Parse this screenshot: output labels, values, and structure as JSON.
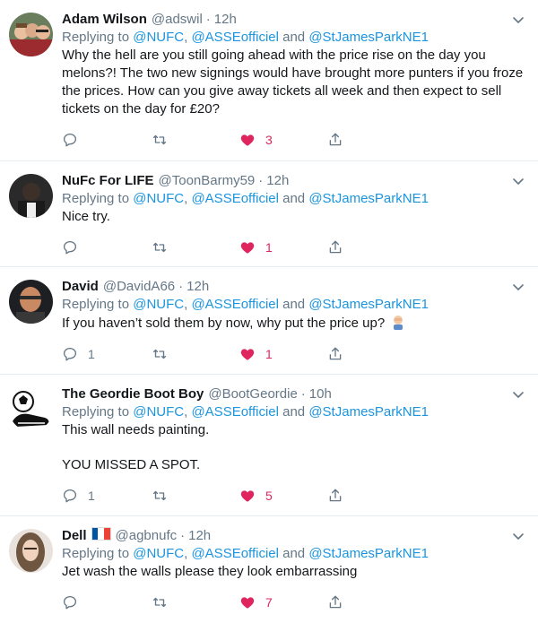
{
  "tweets": [
    {
      "name": "Adam Wilson",
      "handle": "@adswil",
      "time": "12h",
      "replying_prefix": "Replying to",
      "mention_a": "@NUFC",
      "mention_b": "@ASSEofficiel",
      "and": "and",
      "mention_c": "@StJamesParkNE1",
      "text1": "Why the hell are you still going ahead with the price rise on the day you melons?! The two new signings would have brought more punters if you froze the prices. How can you give away tickets all week and then expect to sell tickets on the day for £20?",
      "reply_count": "",
      "like_count": "3"
    },
    {
      "name": "NuFc For LIFE",
      "handle": "@ToonBarmy59",
      "time": "12h",
      "replying_prefix": "Replying to",
      "mention_a": "@NUFC",
      "mention_b": "@ASSEofficiel",
      "and": "and",
      "mention_c": "@StJamesParkNE1",
      "text1": "Nice try.",
      "reply_count": "",
      "like_count": "1"
    },
    {
      "name": "David",
      "handle": "@DavidA66",
      "time": "12h",
      "replying_prefix": "Replying to",
      "mention_a": "@NUFC",
      "mention_b": "@ASSEofficiel",
      "and": "and",
      "mention_c": "@StJamesParkNE1",
      "text1": "If you haven’t sold them by now, why put the price up?",
      "emoji": "man-facepalming",
      "reply_count": "1",
      "like_count": "1"
    },
    {
      "name": "The Geordie Boot Boy",
      "handle": "@BootGeordie",
      "time": "10h",
      "replying_prefix": "Replying to",
      "mention_a": "@NUFC",
      "mention_b": "@ASSEofficiel",
      "and": "and",
      "mention_c": "@StJamesParkNE1",
      "text1": "This wall needs painting.",
      "text2": "YOU MISSED A SPOT.",
      "reply_count": "1",
      "like_count": "5"
    },
    {
      "name": "Dell",
      "flag": "france",
      "handle": "@agbnufc",
      "time": "12h",
      "replying_prefix": "Replying to",
      "mention_a": "@NUFC",
      "mention_b": "@ASSEofficiel",
      "and": "and",
      "mention_c": "@StJamesParkNE1",
      "text1": "Jet wash the walls please they look embarrassing",
      "reply_count": "",
      "like_count": "7"
    }
  ],
  "colors": {
    "link": "#1b95e0",
    "muted": "#657786",
    "like": "#e0245e",
    "divider": "#e6ecf0"
  },
  "icons": [
    "reply-icon",
    "retweet-icon",
    "heart-icon",
    "share-icon",
    "chevron-down-icon"
  ]
}
